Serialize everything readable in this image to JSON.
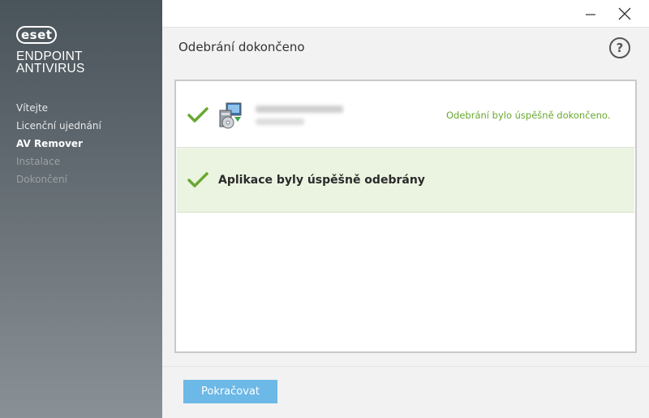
{
  "brand": {
    "logo_text": "eset",
    "product_line1": "ENDPOINT",
    "product_line2": "ANTIVIRUS"
  },
  "steps": [
    {
      "label": "Vítejte",
      "state": "done"
    },
    {
      "label": "Licenční ujednání",
      "state": "done"
    },
    {
      "label": "AV Remover",
      "state": "active"
    },
    {
      "label": "Instalace",
      "state": "disabled"
    },
    {
      "label": "Dokončení",
      "state": "disabled"
    }
  ],
  "window": {
    "minimize_icon": "minimize-icon",
    "close_icon": "close-icon"
  },
  "header": {
    "title": "Odebrání dokončeno",
    "help_label": "?"
  },
  "results": {
    "item_status": "Odebrání bylo úspěšně dokončeno.",
    "summary": "Aplikace byly úspěšně odebrány"
  },
  "footer": {
    "continue_label": "Pokračovat"
  },
  "colors": {
    "accent_green": "#6aa832",
    "button_blue": "#6cb8e6",
    "sidebar_dark": "#4a545b"
  }
}
